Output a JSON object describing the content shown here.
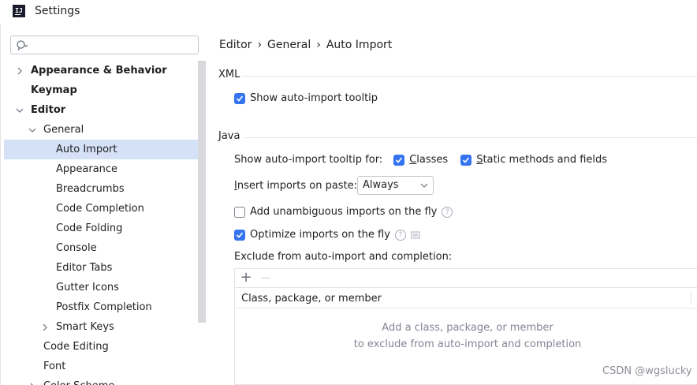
{
  "window": {
    "title": "Settings"
  },
  "search": {
    "placeholder": "",
    "value": ""
  },
  "tree": {
    "appearance_behavior": "Appearance & Behavior",
    "keymap": "Keymap",
    "editor": "Editor",
    "general": "General",
    "auto_import": "Auto Import",
    "appearance": "Appearance",
    "breadcrumbs": "Breadcrumbs",
    "code_completion": "Code Completion",
    "code_folding": "Code Folding",
    "console": "Console",
    "editor_tabs": "Editor Tabs",
    "gutter_icons": "Gutter Icons",
    "postfix_completion": "Postfix Completion",
    "smart_keys": "Smart Keys",
    "code_editing": "Code Editing",
    "font": "Font",
    "color_scheme": "Color Scheme"
  },
  "breadcrumb": {
    "items": [
      "Editor",
      "General",
      "Auto Import"
    ],
    "separator": "›"
  },
  "xml": {
    "title": "XML",
    "show_tooltip": {
      "label": "Show auto-import tooltip",
      "checked": true
    }
  },
  "java": {
    "title": "Java",
    "tooltip_for_label": "Show auto-import tooltip for:",
    "classes": {
      "underlined": "C",
      "rest": "lasses",
      "checked": true
    },
    "static": {
      "underlined": "S",
      "rest": "tatic methods and fields",
      "checked": true
    },
    "insert_on_paste": {
      "underlined": "I",
      "rest": "nsert imports on paste:",
      "value": "Always"
    },
    "unambiguous": {
      "label": "Add unambiguous imports on the fly",
      "checked": false
    },
    "optimize": {
      "label": "Optimize imports on the fly",
      "checked": true
    },
    "exclude_label": "Exclude from auto-import and completion:",
    "table": {
      "column": "Class, package, or member",
      "add": "+",
      "remove": "—",
      "empty_line1": "Add a class, package, or member",
      "empty_line2": "to exclude from auto-import and completion"
    }
  },
  "help_glyph": "?",
  "watermark": "CSDN @wgslucky",
  "colors": {
    "accent": "#3574f0",
    "selection": "#d5e1f7",
    "muted_text": "#818594"
  }
}
